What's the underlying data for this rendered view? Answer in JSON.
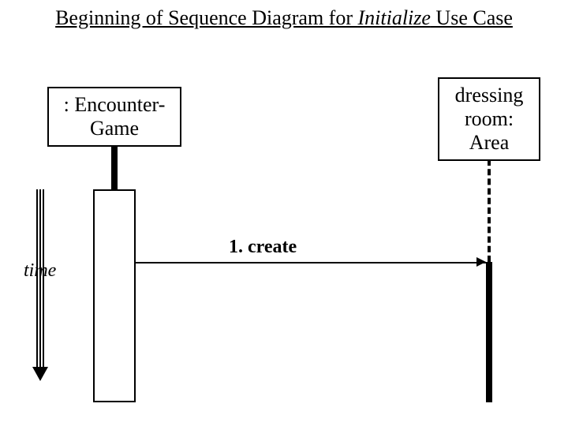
{
  "title": {
    "pre": "Beginning of Sequence Diagram for ",
    "ital": "Initialize",
    "post": " Use Case"
  },
  "objects": {
    "encounter": {
      "line1": ": Encounter-",
      "line2": "Game"
    },
    "dressing": {
      "line1": "dressing",
      "line2": "room:",
      "line3": "Area"
    }
  },
  "messages": {
    "m1": "1. create"
  },
  "labels": {
    "time": "time"
  }
}
